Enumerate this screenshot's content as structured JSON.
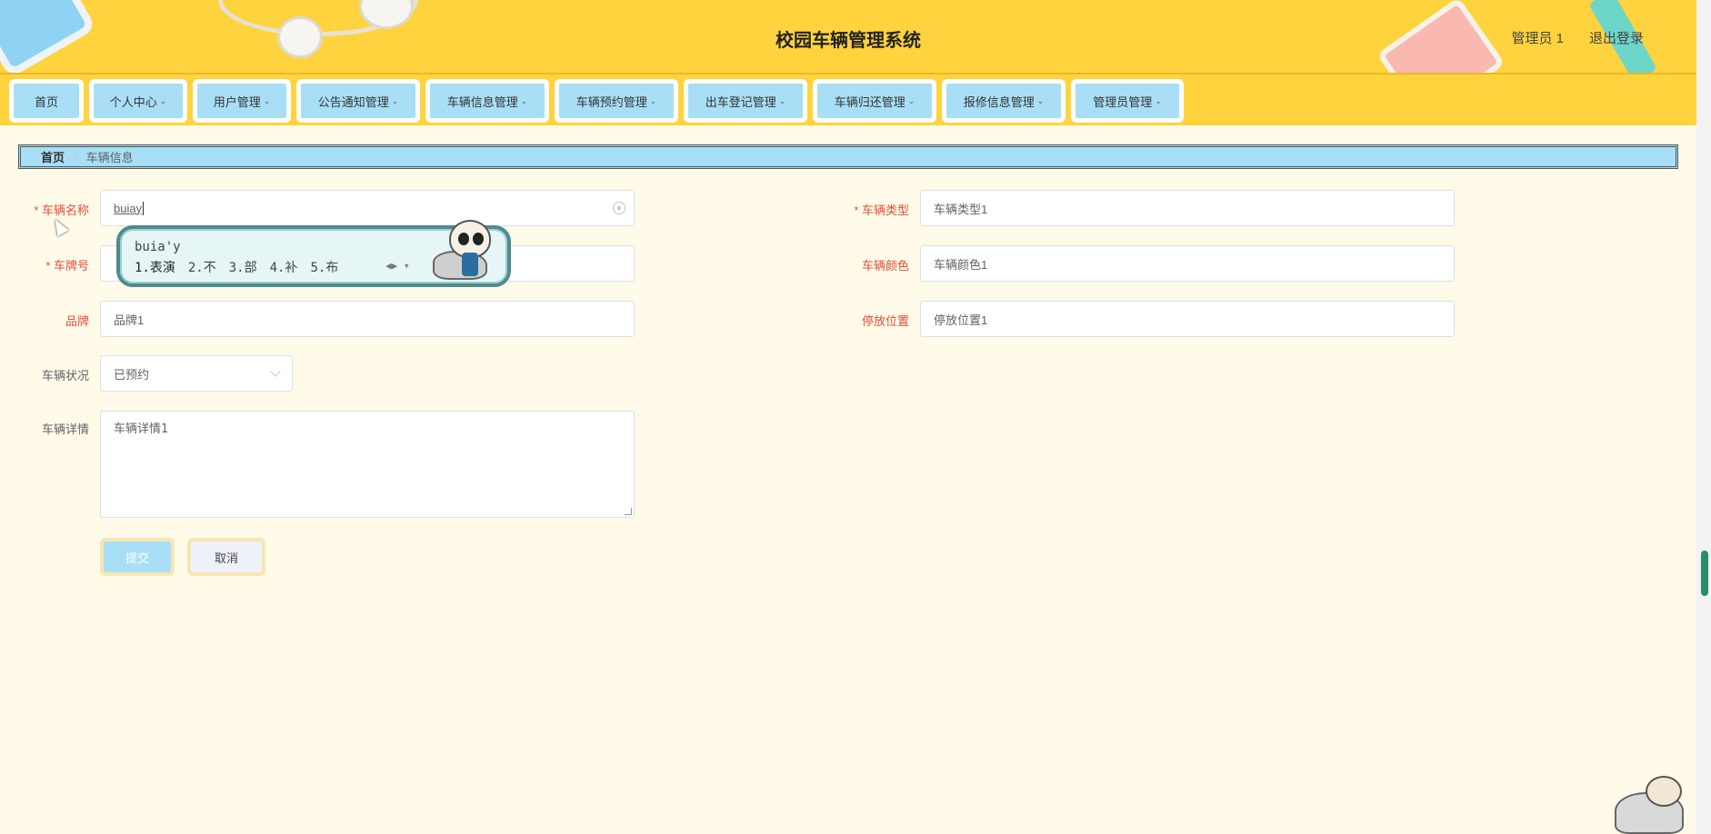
{
  "header": {
    "title": "校园车辆管理系统",
    "user": "管理员 1",
    "logout": "退出登录"
  },
  "nav": [
    {
      "label": "首页",
      "dropdown": false
    },
    {
      "label": "个人中心",
      "dropdown": true
    },
    {
      "label": "用户管理",
      "dropdown": true
    },
    {
      "label": "公告通知管理",
      "dropdown": true
    },
    {
      "label": "车辆信息管理",
      "dropdown": true
    },
    {
      "label": "车辆预约管理",
      "dropdown": true
    },
    {
      "label": "出车登记管理",
      "dropdown": true
    },
    {
      "label": "车辆归还管理",
      "dropdown": true
    },
    {
      "label": "报修信息管理",
      "dropdown": true
    },
    {
      "label": "管理员管理",
      "dropdown": true
    }
  ],
  "breadcrumb": {
    "home": "首页",
    "separator": "/",
    "current": "车辆信息"
  },
  "form": {
    "vehicle_name": {
      "label": "* 车辆名称",
      "value": "buiay"
    },
    "vehicle_type": {
      "label": "* 车辆类型",
      "value": "车辆类型1"
    },
    "plate_number": {
      "label": "* 车牌号",
      "value": ""
    },
    "vehicle_color": {
      "label": "车辆颜色",
      "value": "车辆颜色1"
    },
    "brand": {
      "label": "品牌",
      "value": "品牌1"
    },
    "parking_location": {
      "label": "停放位置",
      "value": "停放位置1"
    },
    "vehicle_status": {
      "label": "车辆状况",
      "value": "已预约"
    },
    "vehicle_details": {
      "label": "车辆详情",
      "value": "车辆详情1"
    },
    "submit_label": "提交",
    "cancel_label": "取消"
  },
  "ime": {
    "pinyin": "buia'y",
    "candidates": [
      "1.表演",
      "2.不",
      "3.部",
      "4.补",
      "5.布"
    ]
  },
  "colors": {
    "header_bg": "#ffd33d",
    "nav_item_bg": "#a8dff6",
    "page_bg": "#fffbe8",
    "required_label": "#e74c3c"
  }
}
